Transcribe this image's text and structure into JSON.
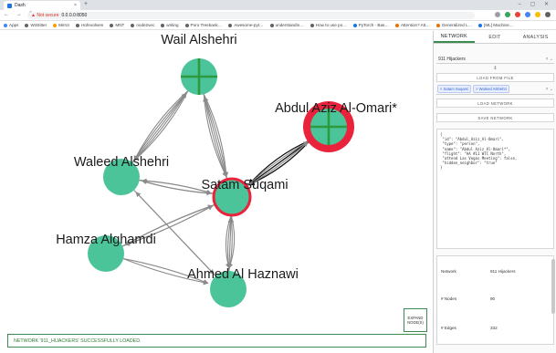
{
  "browser": {
    "tab_title": "Dash",
    "tab_close": "×",
    "new_tab": "+",
    "window_controls": "–  ▢  ✕",
    "nav_glyphs": "← → C",
    "security": "▲ Not secure",
    "url": "0.0.0.0:8050",
    "bookmarks": [
      "Apps",
      "W3Sitter",
      "Mirror",
      "Hofevolsem",
      "MNT",
      "node2vec",
      "writing",
      "Poro Treebank…",
      "Awesome-pyt…",
      "understandin…",
      "How to use po…",
      "PyTorch - Bas…",
      "Attention? Att…",
      "Generalized L…",
      "[ML] Machine…"
    ]
  },
  "graph": {
    "nodes": [
      {
        "label": "Wail Alshehri",
        "shape": "cross"
      },
      {
        "label": "Abdul Aziz Al-Omari*",
        "shape": "cross-highlighted"
      },
      {
        "label": "Waleed Alshehri",
        "shape": "plain"
      },
      {
        "label": "Satam Suqami",
        "shape": "selected"
      },
      {
        "label": "Hamza Alghamdi",
        "shape": "plain"
      },
      {
        "label": "Ahmed Al Haznawi",
        "shape": "plain"
      }
    ],
    "colors": {
      "node": "#4cc49a",
      "highlight": "#e8233b",
      "cross": "#2c9a3e",
      "edge": "#8a8a8a",
      "selected_edge": "#111111"
    }
  },
  "expand_button": "EXPAND NODE(S)",
  "status": "NETWORK '911_HIJACKERS' SUCCESSFULLY LOADED.",
  "panel": {
    "tabs": [
      "NETWORK",
      "EDIT",
      "ANALYSIS"
    ],
    "network_select": "911 Hijackers",
    "select_controls": "× ⌄",
    "separator": "⇕",
    "load_from_file": "LOAD FROM FILE",
    "chips": [
      "× Satam Suqami",
      "× Waleed Alshehri"
    ],
    "load_network": "LOAD NETWORK",
    "save_network": "SAVE NETWORK",
    "json_text": "{\n \"id\": \"Abdul_Aziz_Al-Omari\",\n \"type\": \"person\",\n \"name\": \"Abdul Aziz Al-Omari*\",\n \"flight\": \"AA #11 WTC North\",\n \"attend Las Vegas Meeting\": false,\n \"hidden_neighbor\": \"true\"\n}",
    "stats": [
      {
        "key": "Network",
        "value": "911 Hijackers"
      },
      {
        "key": "# Nodes",
        "value": "90"
      },
      {
        "key": "# Edges",
        "value": "332"
      }
    ]
  }
}
